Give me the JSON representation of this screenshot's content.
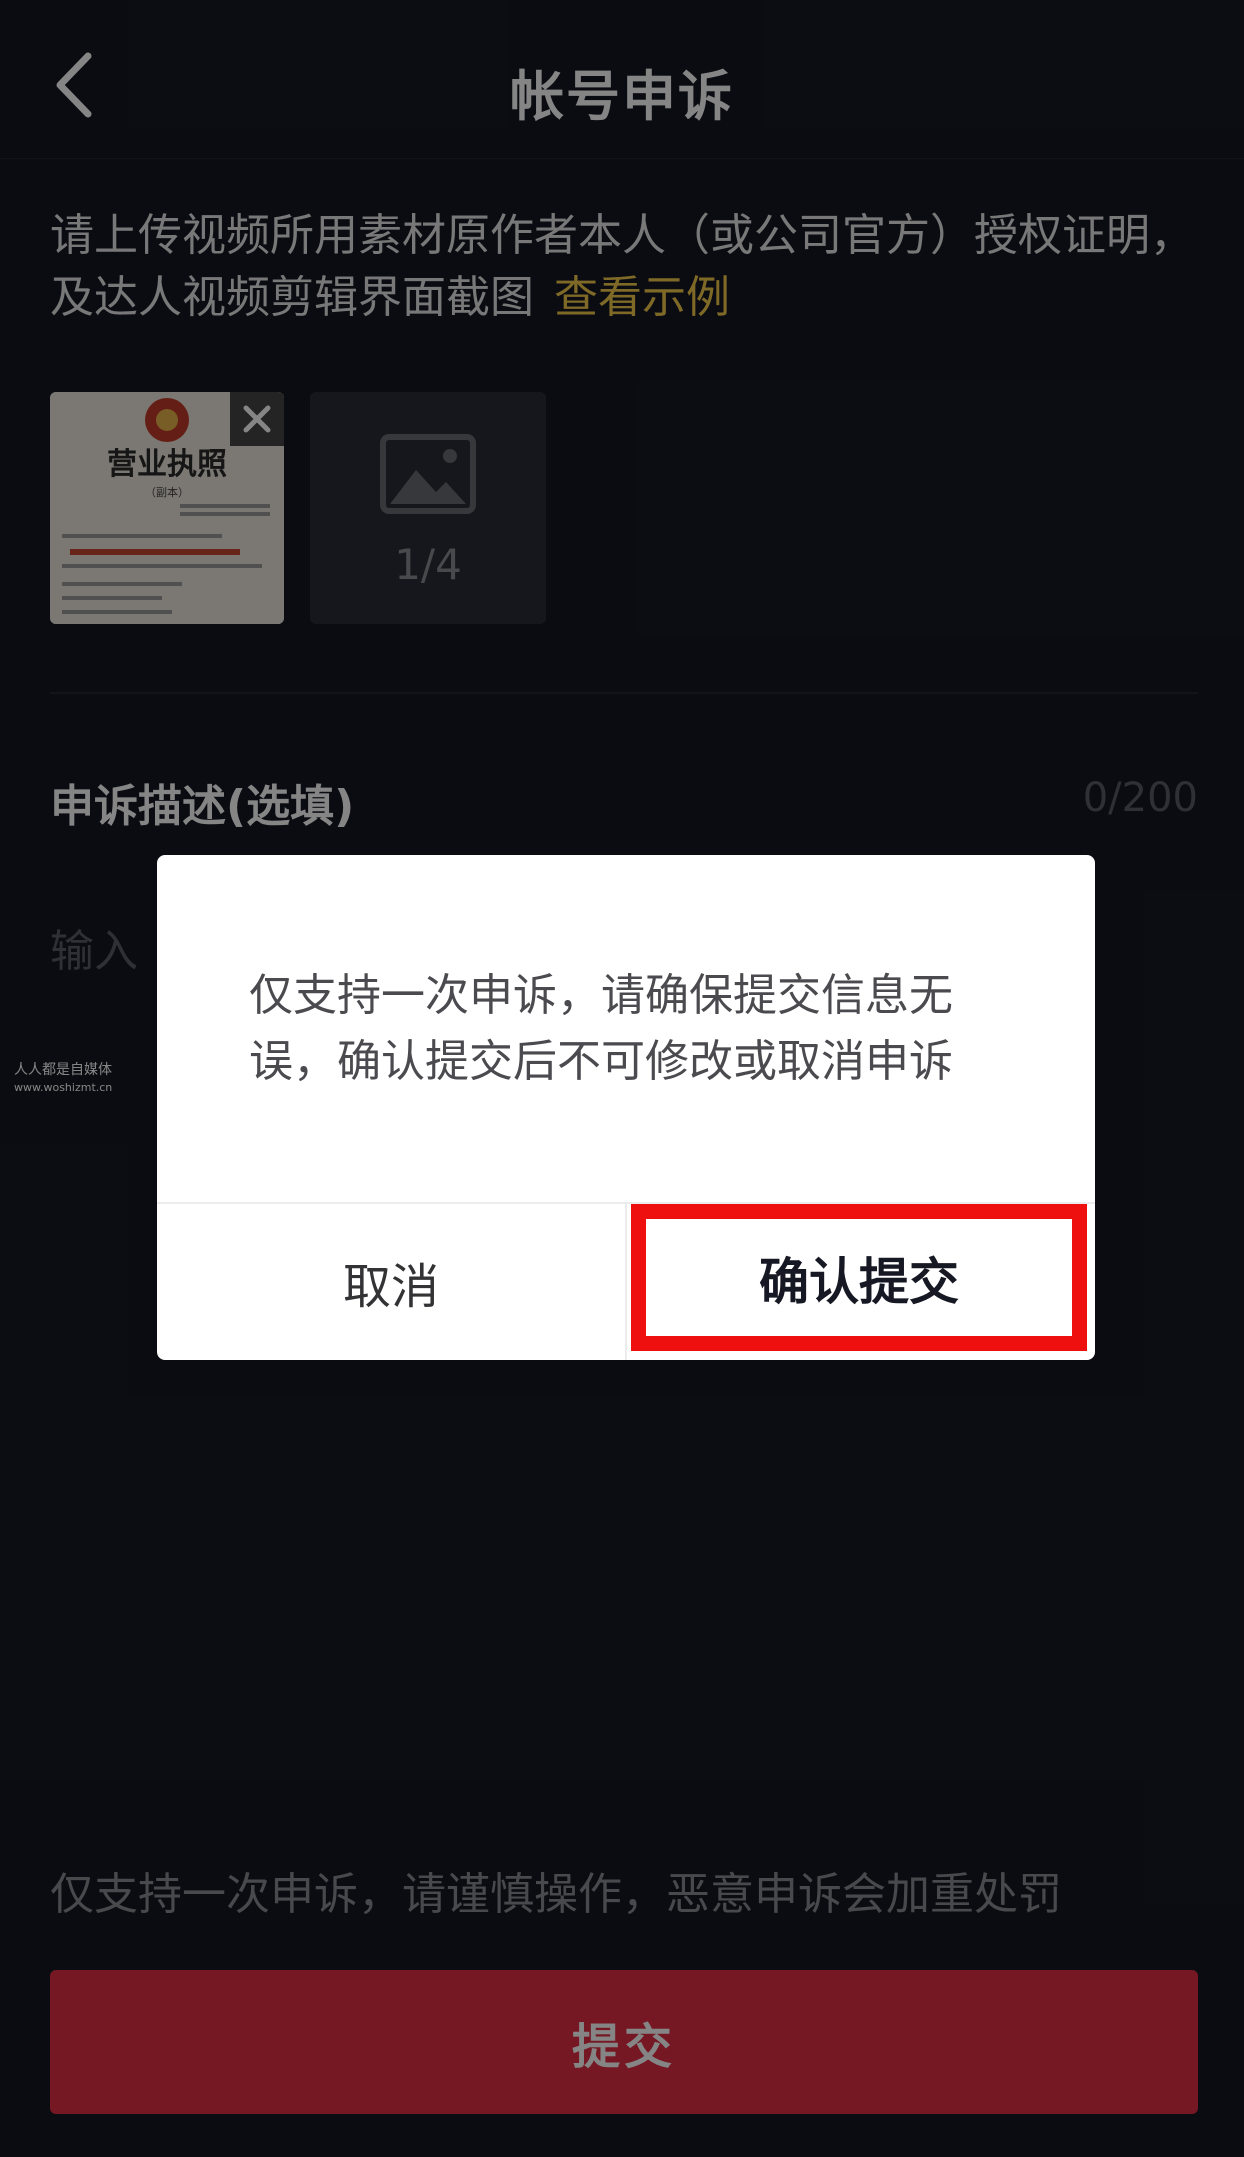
{
  "header": {
    "title": "帐号申诉"
  },
  "instructions": {
    "text": "请上传视频所用素材原作者本人（或公司官方）授权证明，及达人视频剪辑界面截图",
    "example_link": "查看示例"
  },
  "upload": {
    "thumbnail": {
      "title": "营业执照",
      "subtitle": "（副本）"
    },
    "count_text": "1/4"
  },
  "description": {
    "label": "申诉描述(选填)",
    "count": "0/200",
    "placeholder": "输入"
  },
  "watermark": {
    "line1": "人人都是自媒体",
    "line2": "www.woshizmt.cn"
  },
  "footer": {
    "notice": "仅支持一次申诉，请谨慎操作，恶意申诉会加重处罚",
    "submit_label": "提交"
  },
  "dialog": {
    "message": "仅支持一次申诉，请确保提交信息无误，确认提交后不可修改或取消申诉",
    "cancel_label": "取消",
    "confirm_label": "确认提交"
  },
  "colors": {
    "background": "#161823",
    "accent": "#e02f44",
    "link": "#f2c94c",
    "highlight": "#ee0f0f"
  }
}
